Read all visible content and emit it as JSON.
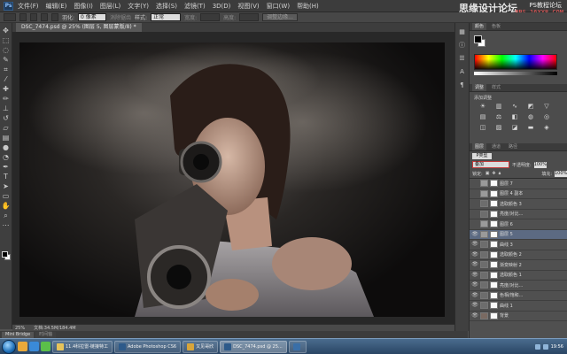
{
  "menubar": {
    "logo": "Ps",
    "items": [
      "文件(F)",
      "编辑(E)",
      "图像(I)",
      "图层(L)",
      "文字(Y)",
      "选择(S)",
      "滤镜(T)",
      "3D(D)",
      "视图(V)",
      "窗口(W)",
      "帮助(H)"
    ]
  },
  "watermark": {
    "title": "思缘设计论坛",
    "site_cn": "PS教程论坛",
    "site_url": "BBS.16XX8.COM"
  },
  "options": {
    "feather_label": "羽化:",
    "feather_value": "0 像素",
    "antialias_label": "消除锯齿",
    "style_label": "样式:",
    "style_value": "正常",
    "width_label": "宽度:",
    "height_label": "高度:",
    "refine_edge": "调整边缘..."
  },
  "document": {
    "tab_title": "DSC_7474.psd @ 25% (图层 5, 图层蒙版/8) *"
  },
  "status": {
    "zoom": "25%",
    "doc_size": "文档:34.5M/184.4M"
  },
  "bottom_tabs": [
    "Mini Bridge",
    "时间轴"
  ],
  "panels": {
    "color_tabs": [
      "颜色",
      "色板"
    ],
    "adjust_tabs": [
      "调整",
      "样式"
    ],
    "adjust_title": "添加调整",
    "layers_tabs": [
      "图层",
      "通道",
      "路径"
    ],
    "filter_label": "P类型",
    "blend_mode": "叠加",
    "opacity_label": "不透明度:",
    "opacity_value": "100%",
    "lock_label": "锁定:",
    "fill_label": "填充:",
    "fill_value": "100%"
  },
  "layers": [
    {
      "name": "图层 7",
      "visible": false,
      "type": "image"
    },
    {
      "name": "图层 4 副本",
      "visible": false,
      "type": "image"
    },
    {
      "name": "选取颜色 3",
      "visible": false,
      "type": "adjust"
    },
    {
      "name": "亮度/对比...",
      "visible": false,
      "type": "adjust"
    },
    {
      "name": "图层 6",
      "visible": false,
      "type": "image"
    },
    {
      "name": "图层 5",
      "visible": true,
      "type": "image",
      "selected": true
    },
    {
      "name": "曲线 3",
      "visible": true,
      "type": "adjust"
    },
    {
      "name": "选取颜色 2",
      "visible": true,
      "type": "adjust"
    },
    {
      "name": "渐变映射 2",
      "visible": true,
      "type": "adjust"
    },
    {
      "name": "选取颜色 1",
      "visible": true,
      "type": "adjust"
    },
    {
      "name": "亮度/对比...",
      "visible": true,
      "type": "adjust"
    },
    {
      "name": "色相/饱和...",
      "visible": true,
      "type": "adjust"
    },
    {
      "name": "曲线 1",
      "visible": true,
      "type": "adjust"
    },
    {
      "name": "背景",
      "visible": true,
      "type": "image"
    }
  ],
  "taskbar": {
    "tasks": [
      {
        "label": "11.4科拉雷-链接特工",
        "color": "#e6c35a"
      },
      {
        "label": "Adobe Photoshop CS6",
        "color": "#2d5a8a"
      },
      {
        "label": "又见哥欣",
        "color": "#d8a53a"
      },
      {
        "label": "DSC_7474.psd @ 25...",
        "color": "#2d5a8a"
      },
      {
        "label": "",
        "color": "#3a6fa8"
      }
    ],
    "clock": "19:56"
  }
}
